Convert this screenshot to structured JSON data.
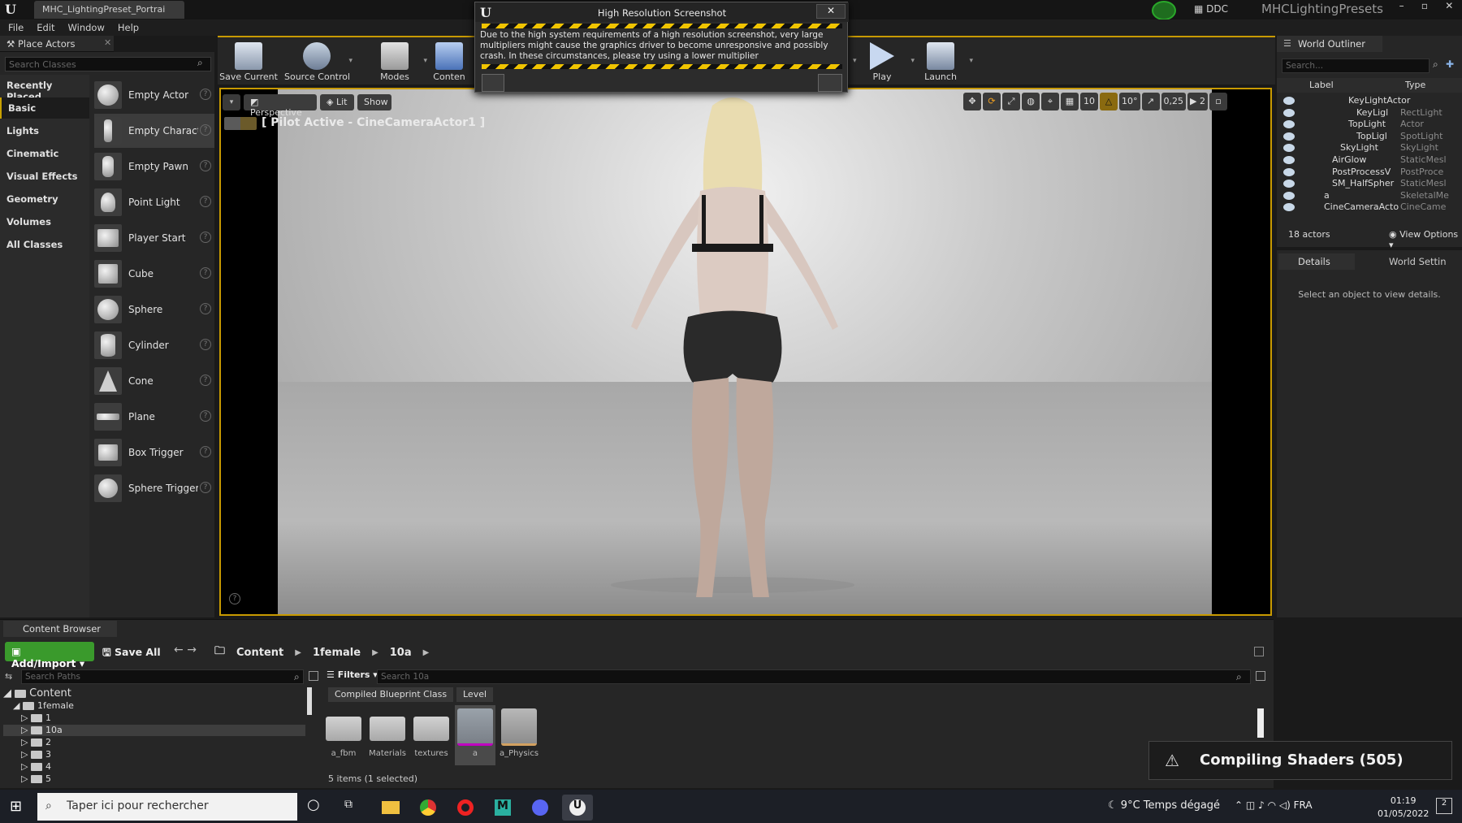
{
  "title_bar": {
    "tab": "MHC_LightingPreset_Portrai",
    "ddc": "DDC",
    "project": "MHCLightingPresets"
  },
  "menu": [
    "File",
    "Edit",
    "Window",
    "Help"
  ],
  "place_actors": {
    "title": "Place Actors",
    "search_placeholder": "Search Classes",
    "categories": [
      "Recently Placed",
      "Basic",
      "Lights",
      "Cinematic",
      "Visual Effects",
      "Geometry",
      "Volumes",
      "All Classes"
    ],
    "active_category": "Basic",
    "actors": [
      "Empty Actor",
      "Empty Charact",
      "Empty Pawn",
      "Point Light",
      "Player Start",
      "Cube",
      "Sphere",
      "Cylinder",
      "Cone",
      "Plane",
      "Box Trigger",
      "Sphere Trigger"
    ]
  },
  "toolbar": {
    "save_current": "Save Current",
    "source_control": "Source Control",
    "modes": "Modes",
    "content": "Conten",
    "play": "Play",
    "launch": "Launch"
  },
  "dialog": {
    "title": "High Resolution Screenshot",
    "message": "Due to the high system requirements of a high resolution screenshot, very large multipliers might cause the graphics driver to become unresponsive and possibly crash. In these circumstances, please try using a lower multiplier",
    "close": "✕"
  },
  "viewport": {
    "perspective": "Perspective",
    "lit": "Lit",
    "show": "Show",
    "pilot_label": "[ Pilot Active - CineCameraActor1 ]",
    "grid_snap": "10",
    "rotation_snap": "10°",
    "scale_snap": "0,25",
    "camera_speed": "2"
  },
  "outliner": {
    "title": "World Outliner",
    "search_placeholder": "Search...",
    "col_label": "Label",
    "col_type": "Type",
    "rows": [
      {
        "name": "KeyLightActor",
        "type": "",
        "indent": 88
      },
      {
        "name": "KeyLigl",
        "type": "RectLight",
        "indent": 98
      },
      {
        "name": "TopLight",
        "type": "Actor",
        "indent": 88
      },
      {
        "name": "TopLigl",
        "type": "SpotLight",
        "indent": 98
      },
      {
        "name": "SkyLight",
        "type": "SkyLight",
        "indent": 78
      },
      {
        "name": "AirGlow",
        "type": "StaticMesl",
        "indent": 68
      },
      {
        "name": "PostProcessV",
        "type": "PostProce",
        "indent": 68
      },
      {
        "name": "SM_HalfSpher",
        "type": "StaticMesl",
        "indent": 68
      },
      {
        "name": "a",
        "type": "SkeletalMe",
        "indent": 58
      },
      {
        "name": "CineCameraActo",
        "type": "CineCame",
        "indent": 58
      }
    ],
    "actor_count": "18 actors",
    "view_options": "View Options"
  },
  "details": {
    "tab": "Details",
    "world_tab": "World Settin",
    "empty_message": "Select an object to view details."
  },
  "content_browser": {
    "title": "Content Browser",
    "add_import": "Add/Import",
    "save_all": "Save All",
    "breadcrumb": [
      "Content",
      "1female",
      "10a"
    ],
    "search_paths_placeholder": "Search Paths",
    "tree": [
      "Content",
      "1female",
      "1",
      "10a",
      "2",
      "3",
      "4",
      "5"
    ],
    "filters": "Filters",
    "search_placeholder": "Search 10a",
    "chips": [
      "Compiled Blueprint Class",
      "Level"
    ],
    "assets": [
      "a_fbm",
      "Materials",
      "textures",
      "a",
      "a_Physics"
    ],
    "items_count": "5 items (1 selected)"
  },
  "notification": {
    "text": "Compiling Shaders (505)"
  },
  "taskbar": {
    "search": "Taper ici pour rechercher",
    "weather": "9°C  Temps dégagé",
    "lang": "FRA",
    "time": "01:19",
    "date": "01/05/2022",
    "notif_count": "2"
  }
}
